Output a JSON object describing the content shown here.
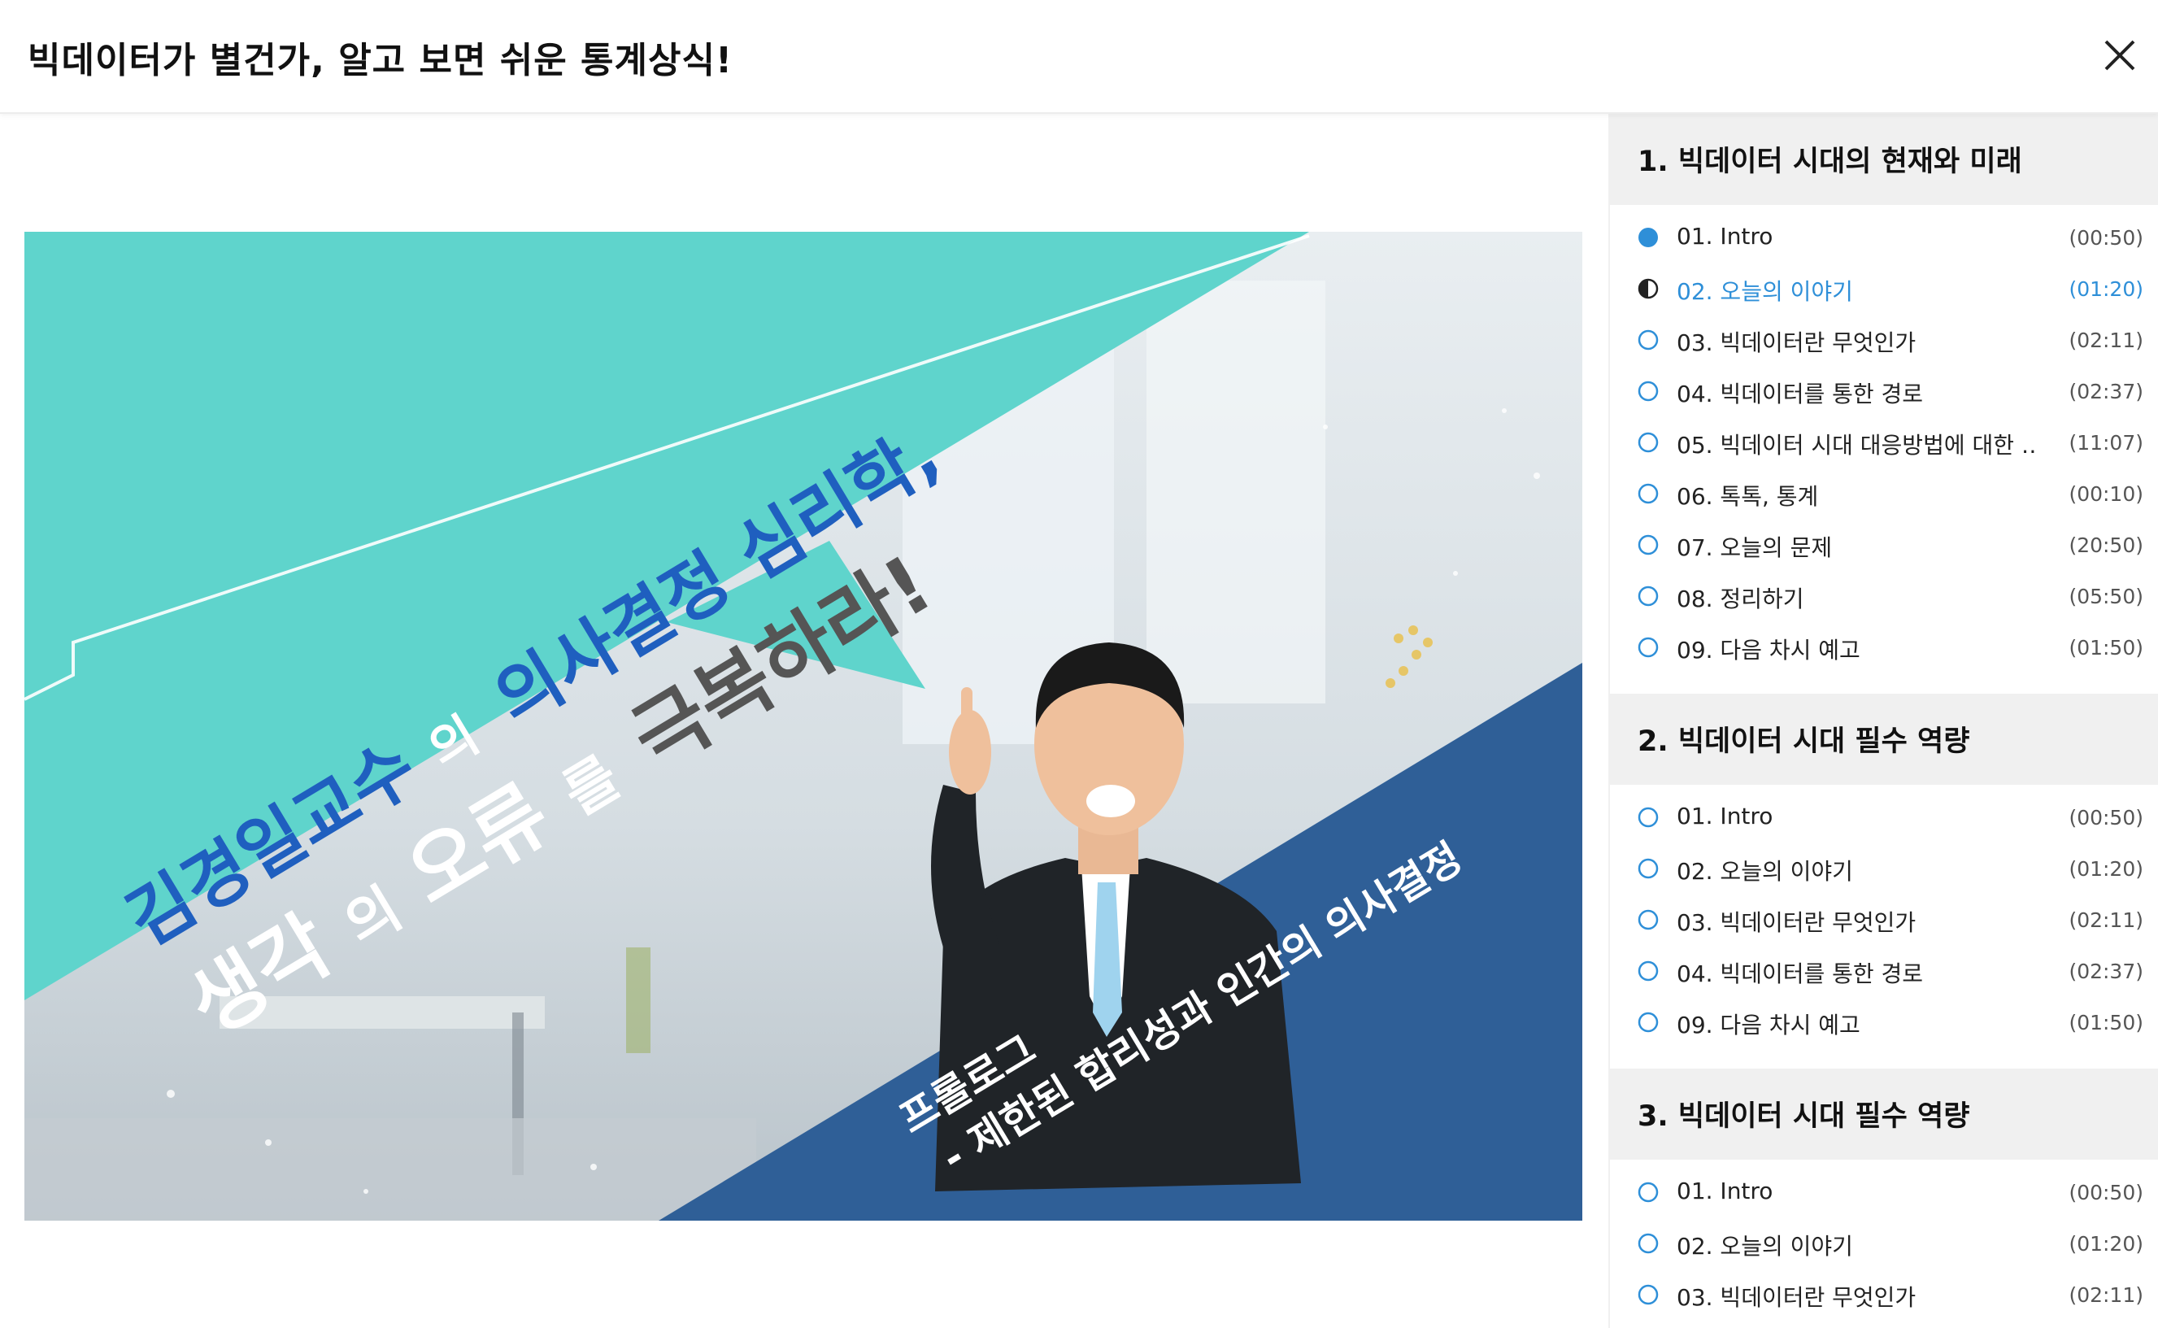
{
  "header": {
    "title": "빅데이터가 별건가, 알고 보면 쉬운 통계상식!"
  },
  "video": {
    "headline_line1_a": "김경일교수",
    "headline_line1_b": "의",
    "headline_line1_c": "의사결정 심리학,",
    "headline_line2_a": "생각",
    "headline_line2_b": "의",
    "headline_line2_c": "오류",
    "headline_line2_d": "를",
    "headline_line2_e": "극복하라!",
    "subtitle_line1": "프롤로그",
    "subtitle_line2": "- 제한된 합리성과 인간의 의사결정"
  },
  "colors": {
    "accent": "#2e8fd8",
    "teal": "#5fd4cc",
    "navy": "#2f5f97",
    "headline_blue": "#1f5fbf"
  },
  "sections": [
    {
      "title": "1. 빅데이터 시대의 현재와 미래",
      "items": [
        {
          "label": "01. Intro",
          "duration": "(00:50)",
          "status": "done"
        },
        {
          "label": "02. 오늘의 이야기",
          "duration": "(01:20)",
          "status": "current"
        },
        {
          "label": "03. 빅데이터란 무엇인가",
          "duration": "(02:11)",
          "status": "none"
        },
        {
          "label": "04. 빅데이터를 통한 경로",
          "duration": "(02:37)",
          "status": "none"
        },
        {
          "label": "05. 빅데이터 시대 대응방법에 대한 …",
          "duration": "(11:07)",
          "status": "none"
        },
        {
          "label": "06. 톡톡, 통계",
          "duration": "(00:10)",
          "status": "none"
        },
        {
          "label": "07. 오늘의 문제",
          "duration": "(20:50)",
          "status": "none"
        },
        {
          "label": "08. 정리하기",
          "duration": "(05:50)",
          "status": "none"
        },
        {
          "label": "09. 다음 차시 예고",
          "duration": "(01:50)",
          "status": "none"
        }
      ]
    },
    {
      "title": "2. 빅데이터 시대 필수 역량",
      "items": [
        {
          "label": "01. Intro",
          "duration": "(00:50)",
          "status": "none"
        },
        {
          "label": "02. 오늘의 이야기",
          "duration": "(01:20)",
          "status": "none"
        },
        {
          "label": "03. 빅데이터란 무엇인가",
          "duration": "(02:11)",
          "status": "none"
        },
        {
          "label": "04. 빅데이터를 통한 경로",
          "duration": "(02:37)",
          "status": "none"
        },
        {
          "label": "09. 다음 차시 예고",
          "duration": "(01:50)",
          "status": "none"
        }
      ]
    },
    {
      "title": "3. 빅데이터 시대 필수 역량",
      "items": [
        {
          "label": "01. Intro",
          "duration": "(00:50)",
          "status": "none"
        },
        {
          "label": "02. 오늘의 이야기",
          "duration": "(01:20)",
          "status": "none"
        },
        {
          "label": "03. 빅데이터란 무엇인가",
          "duration": "(02:11)",
          "status": "none"
        }
      ]
    }
  ]
}
